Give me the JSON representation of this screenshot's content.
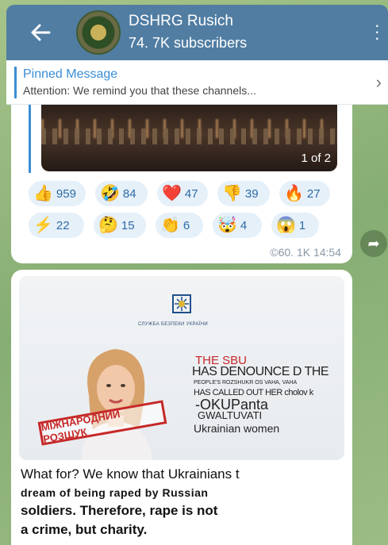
{
  "header": {
    "back_icon": "arrow-left-icon",
    "channel_name": "DSHRG Rusich",
    "subscribers": "74. 7K subscribers",
    "menu_icon": "more-vertical-icon"
  },
  "pinned": {
    "title": "Pinned Message",
    "text": "Attention: We remind you that these channels...",
    "chevron": "›"
  },
  "message1": {
    "photo_counter": "1 of 2",
    "reactions": [
      {
        "emoji": "👍",
        "count": "959"
      },
      {
        "emoji": "🤣",
        "count": "84"
      },
      {
        "emoji": "❤️",
        "count": "47"
      },
      {
        "emoji": "👎",
        "count": "39"
      },
      {
        "emoji": "🔥",
        "count": "27"
      },
      {
        "emoji": "⚡",
        "count": "22"
      },
      {
        "emoji": "🤔",
        "count": "15"
      },
      {
        "emoji": "👏",
        "count": "6"
      },
      {
        "emoji": "🤯",
        "count": "4"
      },
      {
        "emoji": "😱",
        "count": "1"
      }
    ],
    "meta": "©60. 1K 14:54"
  },
  "message2": {
    "poster": {
      "agency": "СЛУЖБА БЕЗПЕКИ УКРАЇНИ",
      "stamp": "МІЖНАРОДНИЙ РОЗШУК",
      "overlay_1": "THE SBU",
      "overlay_2": "HAS DENOUNCE D THE",
      "overlay_3": "PEOPLE'S ROZSHUKR OS VAHA, VAHA",
      "overlay_4": "HAS CALLED OUT HER cholov k",
      "overlay_5": "-OKUPanta",
      "overlay_6": "GWALTUVATI",
      "overlay_7": "Ukrainian women"
    },
    "caption_1": "What for? We know that Ukrainians t",
    "caption_2": "dream of being raped by Russian",
    "caption_3": "soldiers. Therefore, rape is not",
    "caption_4": "a crime, but charity."
  },
  "colors": {
    "header_bg": "#517da2",
    "accent": "#3a8ed6",
    "reaction_bg": "#e6f0f9",
    "stamp_red": "#c62828"
  }
}
